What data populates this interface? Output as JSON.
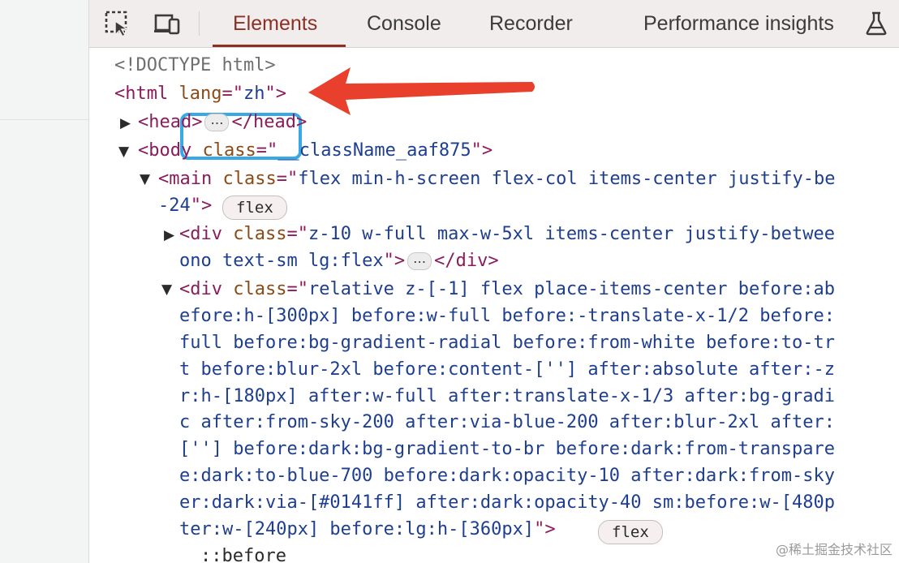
{
  "toolbar": {
    "icons": [
      "inspect-element-icon",
      "device-toggle-icon",
      "experiment-flask-icon"
    ],
    "tabs": [
      {
        "label": "Elements",
        "active": true
      },
      {
        "label": "Console",
        "active": false
      },
      {
        "label": "Recorder",
        "active": false
      },
      {
        "label": "Performance insights",
        "active": false
      }
    ]
  },
  "tree": {
    "doctype": "<!DOCTYPE html>",
    "html_open": "<html",
    "html_attr": "lang",
    "html_eq": "=\"",
    "html_val": "zh",
    "html_close": "\">",
    "head_open": "<head>",
    "head_close": "</head>",
    "ellipsis": "…",
    "body_open": "<body",
    "body_attr": "class",
    "body_val": "__className_aaf875",
    "main_open": "<main",
    "main_attr": "class",
    "main_val_1": "flex min-h-screen flex-col items-center justify-be",
    "main_val_2": "-24",
    "badge_flex": "flex",
    "div1_open": "<div",
    "div1_attr": "class",
    "div1_val_1": "z-10 w-full max-w-5xl items-center justify-betwee",
    "div1_val_2": "ono text-sm lg:flex",
    "div_close": "</div>",
    "div2_open": "<div",
    "div2_attr": "class",
    "div2_lines": [
      "relative z-[-1] flex place-items-center before:ab",
      "efore:h-[300px] before:w-full before:-translate-x-1/2 before:",
      "full before:bg-gradient-radial before:from-white before:to-tr",
      "t before:blur-2xl before:content-[''] after:absolute after:-z",
      "r:h-[180px] after:w-full after:translate-x-1/3 after:bg-gradi",
      "c after:from-sky-200 after:via-blue-200 after:blur-2xl after:",
      "[''] before:dark:bg-gradient-to-br before:dark:from-transpare",
      "e:dark:to-blue-700 before:dark:opacity-10 after:dark:from-sky",
      "er:dark:via-[#0141ff] after:dark:opacity-40 sm:before:w-[480p",
      "ter:w-[240px] before:lg:h-[360px]"
    ],
    "pseudo_before": "::before"
  },
  "watermark": "@稀土掘金技术社区",
  "colors": {
    "active_tab": "#8c2f25",
    "tag": "#8a1c5b",
    "attribute": "#8c4a16",
    "value": "#1e3e8f",
    "highlight_box": "#38a9e6",
    "annotation_arrow": "#e8402c"
  }
}
